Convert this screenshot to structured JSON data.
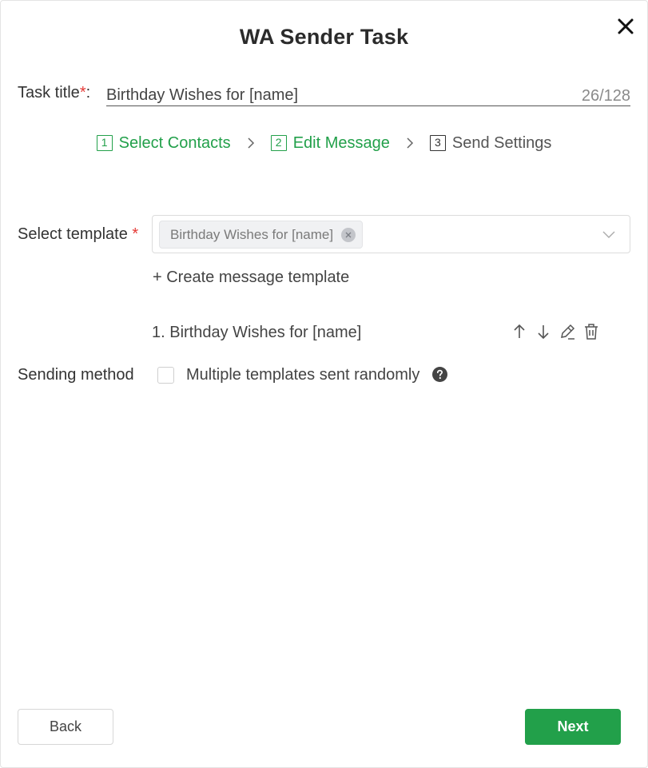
{
  "dialog": {
    "title": "WA Sender Task"
  },
  "task": {
    "label": "Task title",
    "required_mark": "*",
    "colon": ":",
    "value": "Birthday Wishes for [name]",
    "counter": "26/128"
  },
  "steps": [
    {
      "num": "1",
      "label": "Select Contacts",
      "state": "done"
    },
    {
      "num": "2",
      "label": "Edit Message",
      "state": "active"
    },
    {
      "num": "3",
      "label": "Send Settings",
      "state": "todo"
    }
  ],
  "template": {
    "label": "Select template",
    "required_mark": "*",
    "selected_tag": "Birthday Wishes for [name]",
    "create_link": "+ Create message template",
    "items": [
      {
        "label": "1. Birthday Wishes for [name]"
      }
    ]
  },
  "sending": {
    "label": "Sending method",
    "checkbox_label": "Multiple templates sent randomly",
    "checked": false
  },
  "footer": {
    "back_label": "Back",
    "next_label": "Next"
  },
  "colors": {
    "accent": "#22a04a",
    "required": "#e53935"
  },
  "icons": [
    "close-icon",
    "chevron-right-icon",
    "tag-close-icon",
    "chevron-down-icon",
    "arrow-up-icon",
    "arrow-down-icon",
    "edit-icon",
    "trash-icon",
    "help-icon"
  ]
}
